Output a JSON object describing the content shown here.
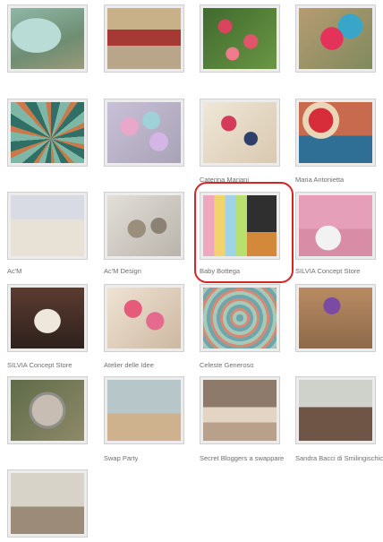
{
  "gallery": {
    "items": [
      {
        "caption": ""
      },
      {
        "caption": ""
      },
      {
        "caption": ""
      },
      {
        "caption": ""
      },
      {
        "caption": ""
      },
      {
        "caption": ""
      },
      {
        "caption": "Caterina Mariani"
      },
      {
        "caption": "Maria Antonietta"
      },
      {
        "caption": "Ac'M"
      },
      {
        "caption": "Ac'M Design"
      },
      {
        "caption": "Baby Bottega"
      },
      {
        "caption": "SILVIA Concept Store"
      },
      {
        "caption": "SILVIA Concept Store"
      },
      {
        "caption": "Atelier delle Idee"
      },
      {
        "caption": "Celeste Generoso"
      },
      {
        "caption": ""
      },
      {
        "caption": ""
      },
      {
        "caption": "Swap Party"
      },
      {
        "caption": "Secret Bloggers a swappare"
      },
      {
        "caption": "Sandra Bacci di Smilingischic"
      },
      {
        "caption": ""
      }
    ],
    "highlight_color": "#d72525"
  }
}
